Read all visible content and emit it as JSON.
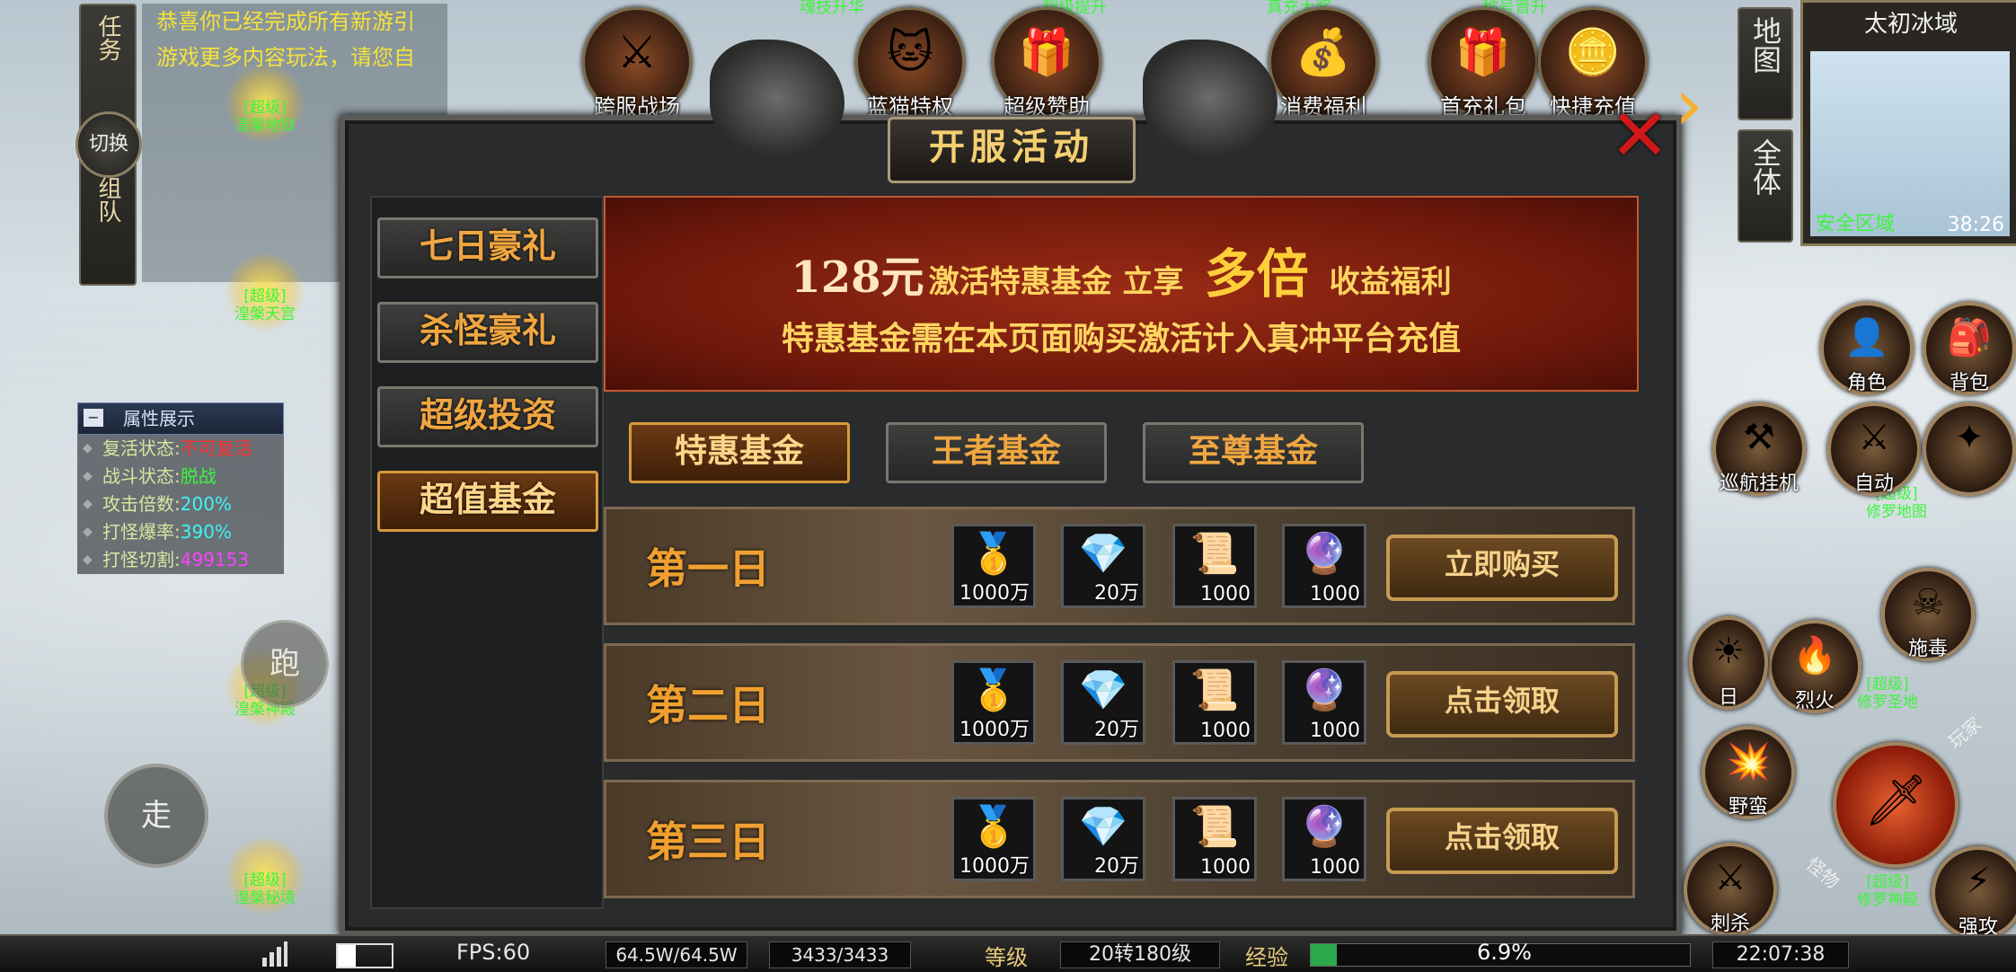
{
  "left_menu": {
    "task": "任务",
    "swap": "切换",
    "team": "组队"
  },
  "chat": [
    "恭喜你已经完成所有新游引",
    "游戏更多内容玩法，请您自"
  ],
  "portals": [
    {
      "tag": "[超级]",
      "name": "湟槃地狱"
    },
    {
      "tag": "[超级]",
      "name": "湟槃天宫"
    },
    {
      "tag": "[超级]",
      "name": "湟槃神殿"
    },
    {
      "tag": "[超级]",
      "name": "湟槃秘境"
    }
  ],
  "attributes": {
    "title": "属性展示",
    "rows": [
      {
        "label": "复活状态:",
        "value": "不可复活",
        "color": "#ff3030"
      },
      {
        "label": "战斗状态:",
        "value": "脱战",
        "color": "#3cf53c"
      },
      {
        "label": "攻击倍数:",
        "value": "200%",
        "color": "#3cf5f5"
      },
      {
        "label": "打怪爆率:",
        "value": "390%",
        "color": "#3cf5f5"
      },
      {
        "label": "打怪切割:",
        "value": "499153",
        "color": "#ff40ff"
      }
    ]
  },
  "run_label": "跑",
  "walk_label": "走",
  "top_icons": [
    {
      "label": "跨服战场",
      "icon": "crossed-swords-icon",
      "glyph": "⚔"
    },
    {
      "label": "蓝猫特权",
      "icon": "cat-mask-icon",
      "glyph": "🐱"
    },
    {
      "label": "超级赞助",
      "icon": "gift-pack-icon",
      "glyph": "🎁"
    },
    {
      "label": "消费福利",
      "icon": "treasure-chest-icon",
      "glyph": "💰"
    },
    {
      "label": "首充礼包",
      "icon": "gift-box-icon",
      "glyph": "🎁"
    },
    {
      "label": "快捷充值",
      "icon": "gold-coins-icon",
      "glyph": "🪙"
    }
  ],
  "top_faint_labels": [
    "魂技升华",
    "超级提升",
    "真充大奖",
    "称号晋升"
  ],
  "dialog": {
    "title": "开服活动",
    "sidebar": [
      "七日豪礼",
      "杀怪豪礼",
      "超级投资",
      "超值基金"
    ],
    "active_sidebar": 3,
    "banner": {
      "price": "128元",
      "text1": "激活特惠基金 立享",
      "highlight": "多倍",
      "text2": "收益福利",
      "line2": "特惠基金需在本页面购买激活计入真冲平台充值"
    },
    "tabs": [
      "特惠基金",
      "王者基金",
      "至尊基金"
    ],
    "active_tab": 0,
    "days": [
      {
        "label": "第一日",
        "button": "立即购买"
      },
      {
        "label": "第二日",
        "button": "点击领取"
      },
      {
        "label": "第三日",
        "button": "点击领取"
      }
    ],
    "rewards": [
      {
        "icon": "gold-ingot-icon",
        "glyph": "🥇",
        "count": "1000万"
      },
      {
        "icon": "diamond-icon",
        "glyph": "💎",
        "count": "20万"
      },
      {
        "icon": "gold-card-icon",
        "glyph": "📜",
        "count": "1000"
      },
      {
        "icon": "purple-scroll-icon",
        "glyph": "🔮",
        "count": "1000"
      }
    ]
  },
  "right_panel": {
    "map_btn": "地图",
    "all_btn": "全体",
    "zone_name": "太初冰域",
    "safe_zone": "安全区域",
    "map_time": "38:26",
    "portal_tags": [
      {
        "tag": "[超级]",
        "name": "修罗地图"
      },
      {
        "tag": "[超级]",
        "name": "修罗圣地"
      },
      {
        "tag": "[超级]",
        "name": "修罗神殿"
      }
    ],
    "buttons": [
      {
        "label": "角色",
        "icon": "character-icon",
        "glyph": "👤"
      },
      {
        "label": "背包",
        "icon": "bag-icon",
        "glyph": "🎒"
      },
      {
        "label": "巡航挂机",
        "icon": "crossed-axes-icon",
        "glyph": "⚒"
      },
      {
        "label": "自动",
        "icon": "auto-sword-icon",
        "glyph": "⚔"
      },
      {
        "label": "",
        "icon": "shuriken-icon",
        "glyph": "✦"
      },
      {
        "label": "施毒",
        "icon": "poison-icon",
        "glyph": "☠"
      },
      {
        "label": "烈火",
        "icon": "fire-sword-icon",
        "glyph": "🔥"
      },
      {
        "label": "野蛮",
        "icon": "barbarian-icon",
        "glyph": "💥"
      },
      {
        "label": "",
        "icon": "main-attack-icon",
        "glyph": "🗡"
      },
      {
        "label": "刺杀",
        "icon": "assassinate-icon",
        "glyph": "⚔"
      },
      {
        "label": "强攻",
        "icon": "strong-attack-icon",
        "glyph": "⚡"
      },
      {
        "label": "日",
        "icon": "sun-skill-icon",
        "glyph": "☀"
      }
    ],
    "side_tags": [
      "玩家",
      "怪物"
    ]
  },
  "bottom_bar": {
    "fps": "FPS:60",
    "hp": "64.5W/64.5W",
    "mp": "3433/3433",
    "level_label": "等级",
    "level": "20转180级",
    "exp_label": "经验",
    "exp_percent": "6.9%",
    "exp_value": 0.069,
    "time": "22:07:38"
  }
}
